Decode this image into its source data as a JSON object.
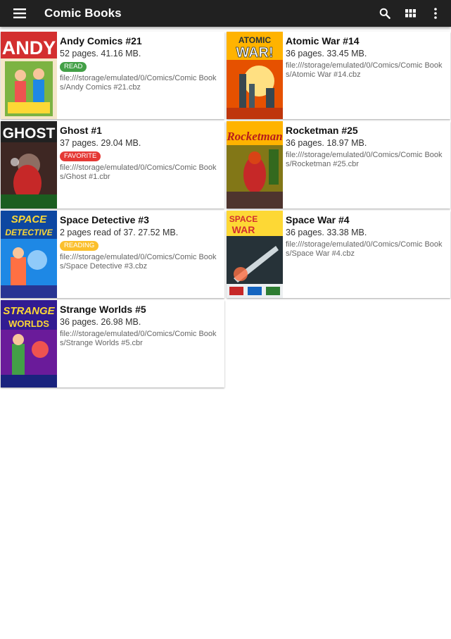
{
  "app": {
    "title": "Comic Books"
  },
  "toolbar": {
    "menu_icon": "hamburger-menu-icon",
    "search_icon": "search-icon",
    "view_icon": "grid-view-icon",
    "more_icon": "more-vert-icon"
  },
  "colors": {
    "appbar": "#212121",
    "read": "#43a047",
    "favorite": "#e53935",
    "reading": "#fbc02d"
  },
  "comics": [
    {
      "title": "Andy Comics #21",
      "meta": "52 pages.  41.16 MB.",
      "badge": "READ",
      "badge_color": "#43a047",
      "path": "file:///storage/emulated/0/Comics/Comic Books/Andy Comics #21.cbz",
      "cover_text": "ANDY"
    },
    {
      "title": "Atomic War #14",
      "meta": "36 pages.  33.45 MB.",
      "badge": "",
      "badge_color": "",
      "path": "file:///storage/emulated/0/Comics/Comic Books/Atomic War #14.cbz",
      "cover_text": "ATOMIC WAR!"
    },
    {
      "title": "Ghost #1",
      "meta": "37 pages.  29.04 MB.",
      "badge": "FAVORITE",
      "badge_color": "#e53935",
      "path": "file:///storage/emulated/0/Comics/Comic Books/Ghost #1.cbr",
      "cover_text": "GHOST"
    },
    {
      "title": "Rocketman #25",
      "meta": "36 pages.  18.97 MB.",
      "badge": "",
      "badge_color": "",
      "path": "file:///storage/emulated/0/Comics/Comic Books/Rocketman #25.cbr",
      "cover_text": "Rocketman"
    },
    {
      "title": "Space Detective #3",
      "meta": "2 pages read of 37.  27.52 MB.",
      "badge": "READING",
      "badge_color": "#fbc02d",
      "path": "file:///storage/emulated/0/Comics/Comic Books/Space Detective #3.cbz",
      "cover_text": "SPACE DETECTIVE"
    },
    {
      "title": "Space War #4",
      "meta": "36 pages.  33.38 MB.",
      "badge": "",
      "badge_color": "",
      "path": "file:///storage/emulated/0/Comics/Comic Books/Space War #4.cbz",
      "cover_text": "SPACE WAR"
    },
    {
      "title": "Strange Worlds #5",
      "meta": "36 pages.  26.98 MB.",
      "badge": "",
      "badge_color": "",
      "path": "file:///storage/emulated/0/Comics/Comic Books/Strange Worlds #5.cbr",
      "cover_text": "STRANGE WORLDS"
    }
  ]
}
